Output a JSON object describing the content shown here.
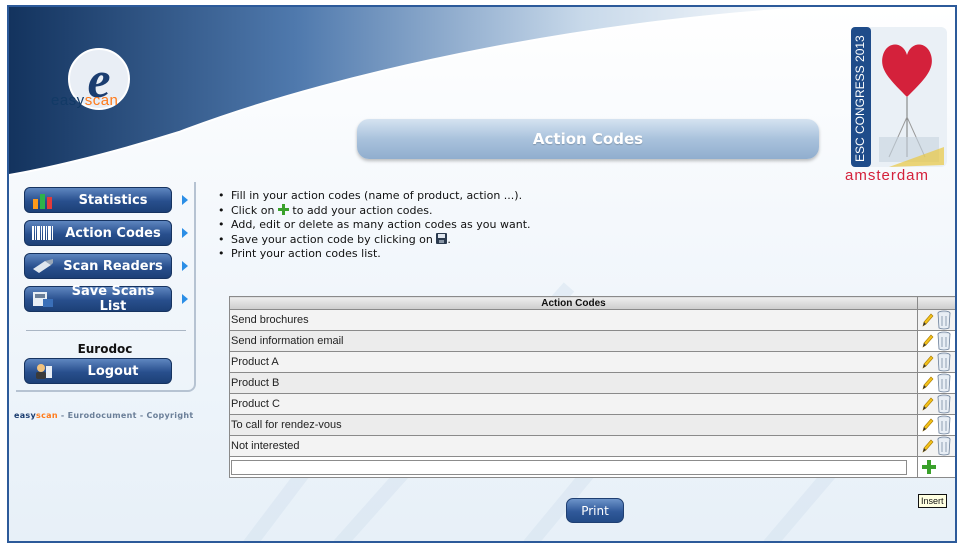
{
  "brand": {
    "logo_letter": "e",
    "name_part1": "easy",
    "name_part2": "scan"
  },
  "event_badge": {
    "text": "ESC CONGRESS 2013",
    "city": "amsterdam"
  },
  "page": {
    "title": "Action Codes"
  },
  "nav": [
    {
      "label": "Statistics",
      "icon": "bar-chart-icon"
    },
    {
      "label": "Action Codes",
      "icon": "barcode-icon"
    },
    {
      "label": "Scan Readers",
      "icon": "scanner-icon"
    },
    {
      "label": "Save Scans List",
      "icon": "save-list-icon"
    }
  ],
  "user": {
    "name": "Eurodoc",
    "logout_label": "Logout"
  },
  "footer": {
    "easy": "easy",
    "scan": "scan",
    "rest": " - Eurodocument - Copyright"
  },
  "instructions": {
    "line1": "Fill in your action codes (name of product, action ...).",
    "line2_pre": "Click on ",
    "line2_post": " to add your action codes.",
    "line3": "Add, edit or delete as many action codes as you want.",
    "line4_pre": "Save your action code by clicking on ",
    "line4_post": ".",
    "line5": "Print your action codes list."
  },
  "table": {
    "header": "Action Codes",
    "rows": [
      "Send brochures",
      "Send information email",
      "Product A",
      "Product B",
      "Product C",
      "To call for rendez-vous",
      "Not interested"
    ],
    "new_value": ""
  },
  "print_label": "Print",
  "tooltip": "Insert",
  "colors": {
    "nav_blue": "#284f8d",
    "accent_orange": "#ff7a1a",
    "badge_red": "#d4213b",
    "insert_green": "#3aa12b"
  }
}
